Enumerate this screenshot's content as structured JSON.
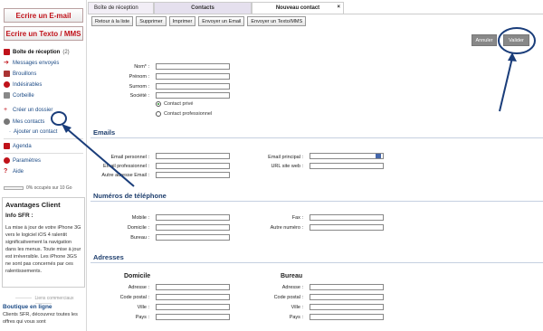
{
  "sidebar": {
    "write_email": "Ecrire un E-mail",
    "write_sms": "Ecrire un Texto / MMS",
    "inbox_label": "Boîte de réception",
    "inbox_count": "(2)",
    "items": [
      "Messages envoyés",
      "Brouillons",
      "Indésirables",
      "Corbeille",
      "Créer un dossier",
      "Mes contacts",
      "Ajouter un contact",
      "Agenda",
      "Paramètres",
      "Aide"
    ],
    "quota": "0% occupés sur 10 Go",
    "promo_title": "Avantages Client",
    "info_title": "Info SFR :",
    "info_text": "La mise à jour de votre iPhone 3G vers le logiciel iOS 4 ralentit significativement la navigation dans les menus. Toute mise à jour est irréversible. Les iPhone 3GS ne sont pas concernés par ces ralentissements.",
    "links_title": "Liens commerciaux",
    "shop_title": "Boutique en ligne",
    "shop_text": "Clients SFR, découvrez toutes les offres qui vous sont"
  },
  "tabs": [
    "Boîte de réception",
    "Contacts",
    "Nouveau contact"
  ],
  "toolbar": [
    "Retour à la liste",
    "Supprimer",
    "Imprimer",
    "Envoyer un Email",
    "Envoyer un Texto/MMS"
  ],
  "actions": {
    "cancel": "Annuler",
    "validate": "Valider"
  },
  "identity": {
    "nom": "Nom* :",
    "prenom": "Prénom :",
    "surnom": "Surnom :",
    "societe": "Société :",
    "radio_private": "Contact privé",
    "radio_pro": "Contact professionnel"
  },
  "emails": {
    "title": "Emails",
    "perso": "Email personnel :",
    "pro": "Email professionnel :",
    "autre": "Autre adresse Email :",
    "principal": "Email principal :",
    "site": "URL site web :"
  },
  "phones": {
    "title": "Numéros de téléphone",
    "mobile": "Mobile :",
    "domicile": "Domicile :",
    "bureau": "Bureau :",
    "fax": "Fax :",
    "autre": "Autre numéro :"
  },
  "addresses": {
    "title": "Adresses",
    "home": "Domicile",
    "office": "Bureau",
    "adresse": "Adresse :",
    "code_postal": "Code postal :",
    "ville": "Ville :",
    "pays": "Pays :"
  },
  "colors": {
    "accent": "#c0121a",
    "section": "#1f3f6e",
    "link": "#1c4b86"
  }
}
